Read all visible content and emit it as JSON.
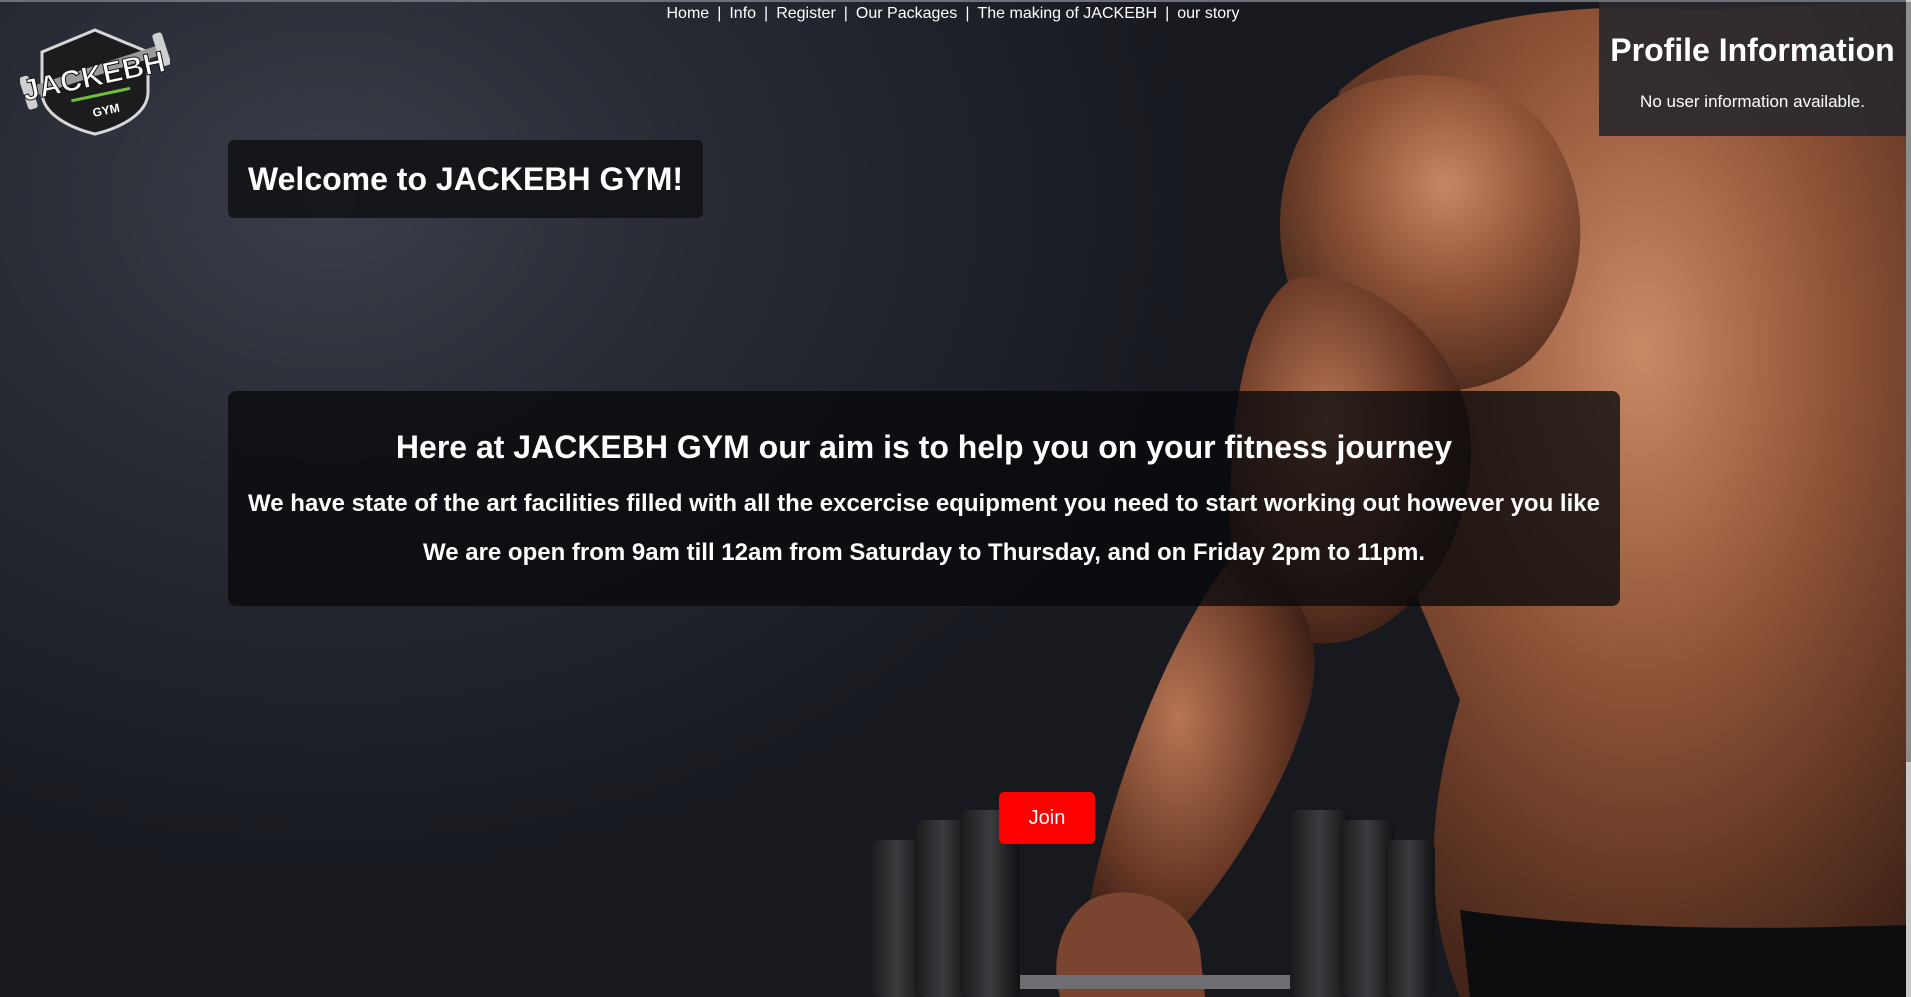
{
  "nav": {
    "items": [
      {
        "label": "Home"
      },
      {
        "label": "Info"
      },
      {
        "label": "Register"
      },
      {
        "label": "Our Packages"
      },
      {
        "label": "The making of JACKEBH"
      },
      {
        "label": "our story"
      }
    ],
    "separator": "|"
  },
  "logo": {
    "text": "JACKEBH",
    "sub": "GYM",
    "icon": "barbell-shield-logo"
  },
  "hero": {
    "welcome": "Welcome to JACKEBH GYM!",
    "heading": "Here at JACKEBH GYM our aim is to help you on your fitness journey",
    "line1": "We have state of the art facilities filled with all the excercise equipment you need to start working out however you like",
    "line2": "We are open from 9am till 12am from Saturday to Thursday, and on Friday 2pm to 11pm."
  },
  "join": {
    "label": "Join",
    "color": "#ff0000"
  },
  "profile": {
    "title": "Profile Information",
    "message": "No user information available."
  },
  "colors": {
    "background": "#24272f",
    "accent": "#ff0000",
    "text": "#ffffff"
  }
}
